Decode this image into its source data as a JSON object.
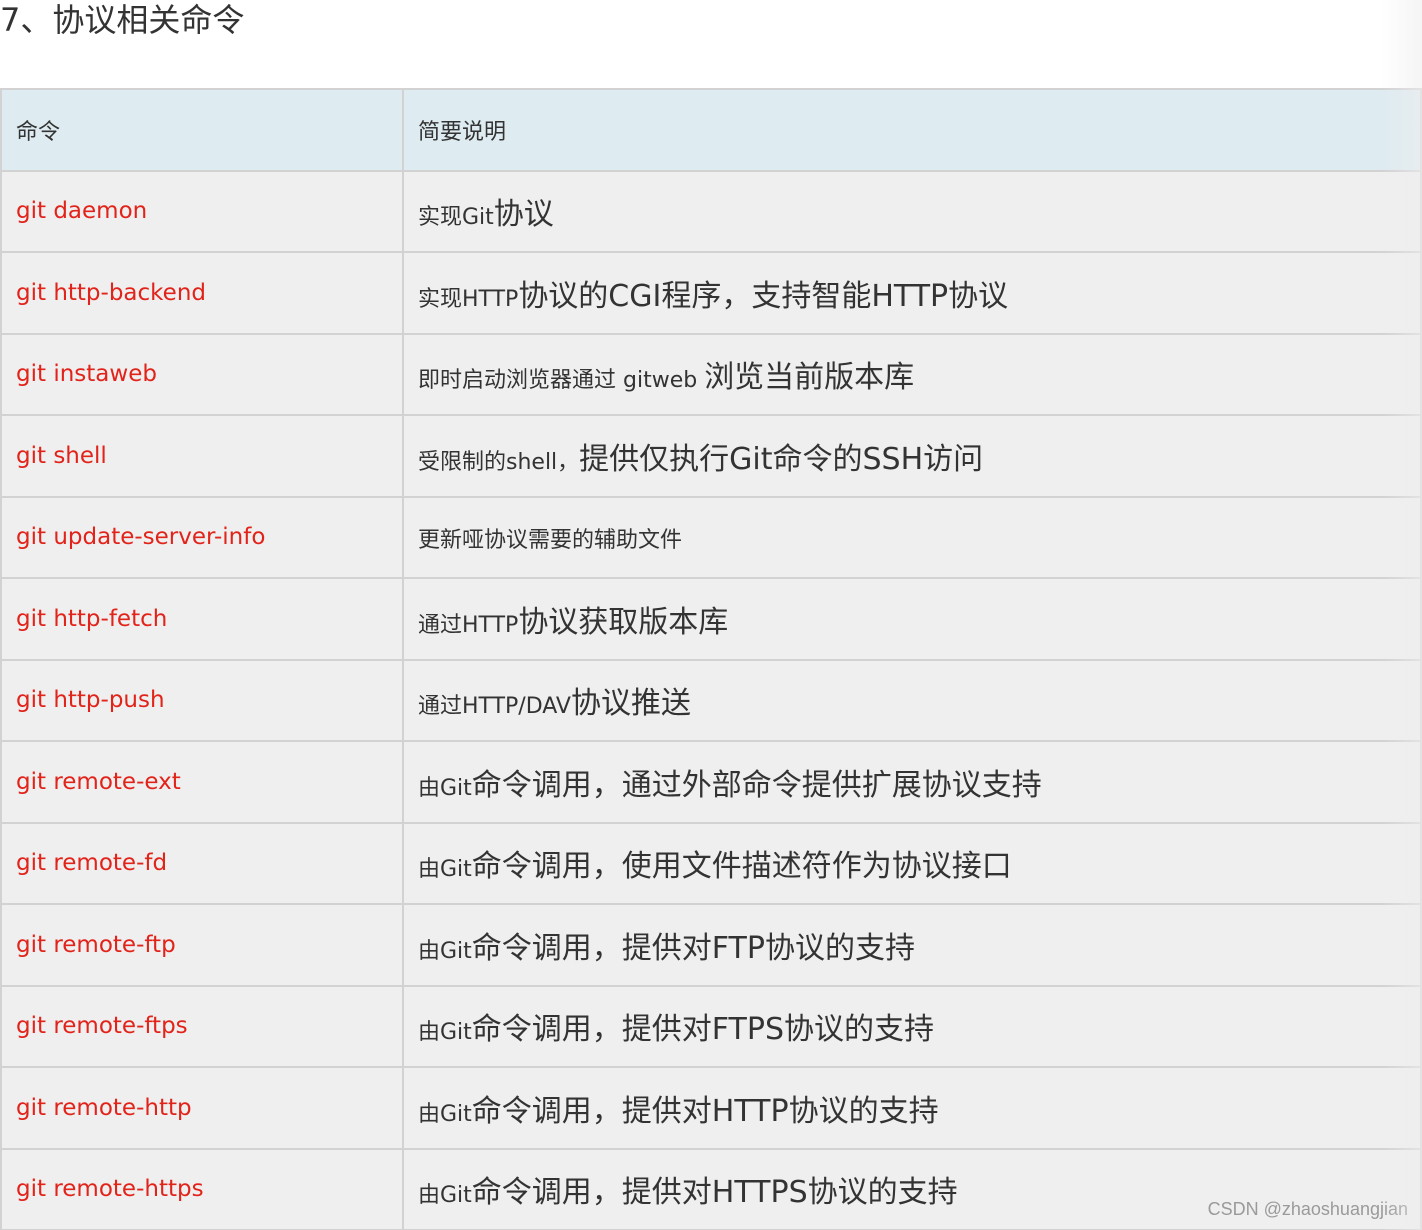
{
  "section_title": "7、协议相关命令",
  "table": {
    "headers": {
      "command": "命令",
      "description": "简要说明"
    },
    "rows": [
      {
        "command": "git daemon",
        "desc_small": "实现Git",
        "desc_big": "协议"
      },
      {
        "command": "git http-backend",
        "desc_small": "实现HTTP",
        "desc_big": "协议的CGI程序，支持智能HTTP协议"
      },
      {
        "command": "git instaweb",
        "desc_small": "即时启动浏览器通过 gitweb ",
        "desc_big": "浏览当前版本库"
      },
      {
        "command": "git shell",
        "desc_small": "受限制的shell，",
        "desc_big": "提供仅执行Git命令的SSH访问"
      },
      {
        "command": "git update-server-info",
        "desc_small": "更新哑协议需要的辅助文件",
        "desc_big": ""
      },
      {
        "command": "git http-fetch",
        "desc_small": "通过HTTP",
        "desc_big": "协议获取版本库"
      },
      {
        "command": "git http-push",
        "desc_small": "通过HTTP/DAV",
        "desc_big": "协议推送"
      },
      {
        "command": "git remote-ext",
        "desc_small": "由Git",
        "desc_big": "命令调用，通过外部命令提供扩展协议支持"
      },
      {
        "command": "git remote-fd",
        "desc_small": "由Git",
        "desc_big": "命令调用，使用文件描述符作为协议接口"
      },
      {
        "command": "git remote-ftp",
        "desc_small": "由Git",
        "desc_big": "命令调用，提供对FTP协议的支持"
      },
      {
        "command": "git remote-ftps",
        "desc_small": "由Git",
        "desc_big": "命令调用，提供对FTPS协议的支持"
      },
      {
        "command": "git remote-http",
        "desc_small": "由Git",
        "desc_big": "命令调用，提供对HTTP协议的支持"
      },
      {
        "command": "git remote-https",
        "desc_small": "由Git",
        "desc_big": "命令调用，提供对HTTPS协议的支持"
      }
    ]
  },
  "watermark": "CSDN @zhaoshuangjian",
  "colors": {
    "command_text": "#e2231a",
    "header_bg": "#deebf1",
    "row_bg": "#efefef",
    "border": "#d2d2d2"
  }
}
